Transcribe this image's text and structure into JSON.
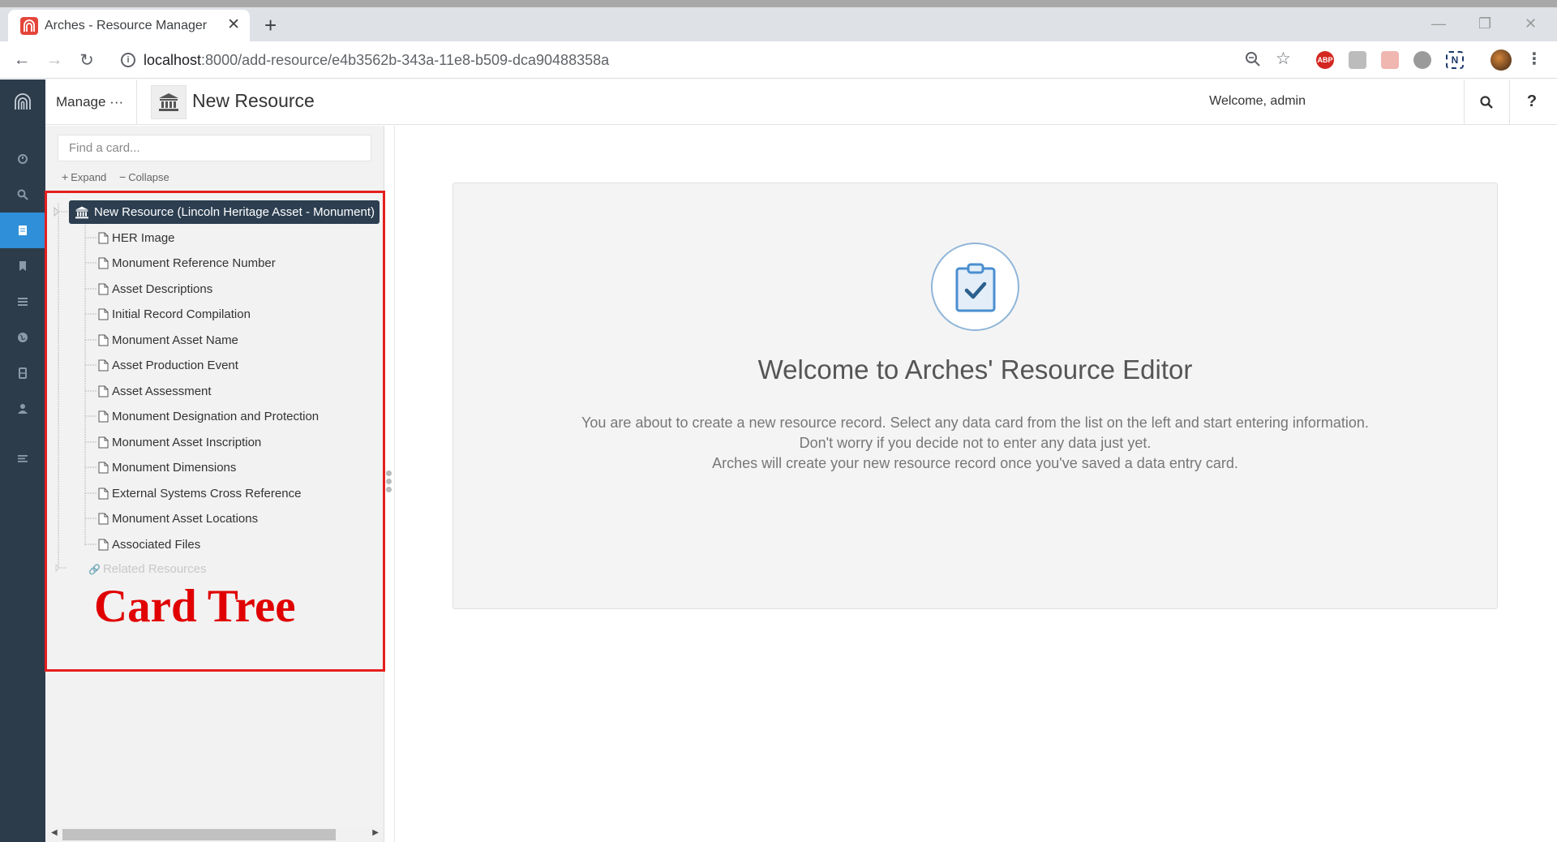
{
  "browser": {
    "tab_title": "Arches - Resource Manager",
    "url_host": "localhost",
    "url_rest": ":8000/add-resource/e4b3562b-343a-11e8-b509-dca90488358a",
    "extensions": [
      "ABP",
      "N"
    ]
  },
  "header": {
    "manage_label": "Manage ···",
    "page_title": "New Resource",
    "welcome": "Welcome, admin",
    "help_label": "?"
  },
  "tree": {
    "search_placeholder": "Find a card...",
    "expand_label": "Expand",
    "collapse_label": "Collapse",
    "root_label": "New Resource (Lincoln Heritage Asset - Monument)",
    "items": [
      "HER Image",
      "Monument Reference Number",
      "Asset Descriptions",
      "Initial Record Compilation",
      "Monument Asset Name",
      "Asset Production Event",
      "Asset Assessment",
      "Monument Designation and Protection",
      "Monument Asset Inscription",
      "Monument Dimensions",
      "External Systems Cross Reference",
      "Monument Asset Locations",
      "Associated Files"
    ],
    "related_label": "Related Resources"
  },
  "annotation": {
    "label": "Card Tree",
    "color": "#e61e1e"
  },
  "main": {
    "title": "Welcome to Arches' Resource Editor",
    "lines": [
      "You are about to create a new resource record. Select any data card from the list on the left and start entering information.",
      "Don't worry if you decide not to enter any data just yet.",
      "Arches will create your new resource record once you've saved a data entry card."
    ]
  },
  "colors": {
    "sidebar": "#2d3c4b",
    "accent": "#2f8fd8",
    "root_node": "#2c3e50"
  }
}
